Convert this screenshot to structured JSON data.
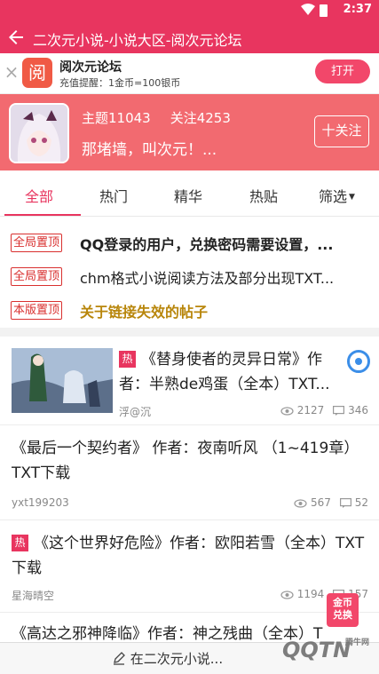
{
  "status_bar": {
    "time": "2:37"
  },
  "app_bar": {
    "title": "二次元小说-小说大区-阅次元论坛"
  },
  "promo": {
    "logo_char": "阅",
    "name": "阅次元论坛",
    "description": "充值提醒：1金币=100银币",
    "open_label": "打开"
  },
  "forum": {
    "topics": "主题11043",
    "follows": "关注4253",
    "slogan": "那堵墙，叫次元！...",
    "follow_label": "十关注"
  },
  "tabs": [
    {
      "label": "全部",
      "active": true
    },
    {
      "label": "热门",
      "active": false
    },
    {
      "label": "精华",
      "active": false
    },
    {
      "label": "热贴",
      "active": false
    },
    {
      "label": "筛选",
      "active": false
    }
  ],
  "pinned": [
    {
      "badge": "全局置顶",
      "text": "QQ登录的用户，兑换密码需要设置，..."
    },
    {
      "badge": "全局置顶",
      "text": "chm格式小说阅读方法及部分出现TXT..."
    },
    {
      "badge": "本版置顶",
      "text": "关于链接失效的帖子"
    }
  ],
  "posts": [
    {
      "hot": "热",
      "title": "《替身使者的灵异日常》作者：半熟de鸡蛋（全本）TXT...",
      "author": "浮@沉",
      "views": "2127",
      "replies": "346"
    },
    {
      "title": "《最后一个契约者》 作者：夜南听风 （1~419章） TXT下载",
      "author": "yxt199203",
      "views": "567",
      "replies": "52"
    },
    {
      "hot": "热",
      "title": "《这个世界好危险》作者：欧阳若雪（全本）TXT下载",
      "author": "星海晴空",
      "views": "1194",
      "replies": "157"
    },
    {
      "title": "《高达之邪神降临》作者：神之残曲（全本）T"
    }
  ],
  "coin_exchange": {
    "line1": "金币",
    "line2": "兑换"
  },
  "bottom": {
    "compose_label": "在二次元小说..."
  },
  "watermark": {
    "text": "QQTN",
    "sub": "腾牛网"
  },
  "colors": {
    "primary": "#e8355f",
    "banner": "#f26a70",
    "pin_badge": "#d9302f"
  }
}
